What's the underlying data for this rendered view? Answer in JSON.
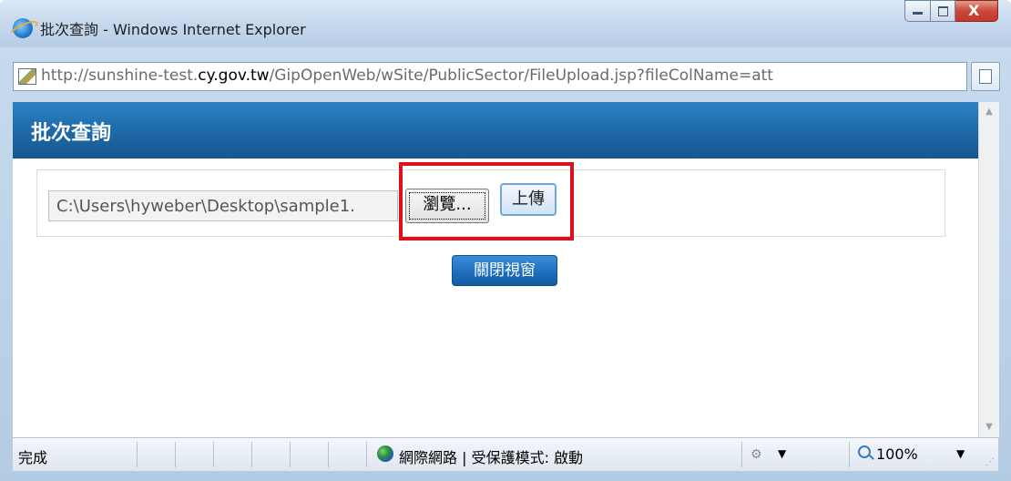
{
  "window": {
    "title": "批次查詢 - Windows Internet Explorer",
    "minimize_icon": "minimize-icon",
    "maximize_icon": "maximize-icon",
    "close_glyph": "X"
  },
  "address_bar": {
    "url_prefix": "http://sunshine-test.",
    "url_host": "cy.gov.tw",
    "url_suffix": "/GipOpenWeb/wSite/PublicSector/FileUpload.jsp?fileColName=att"
  },
  "page": {
    "header_title": "批次查詢",
    "file_input_value": "C:\\Users\\hyweber\\Desktop\\sample1.",
    "browse_label": "瀏覽...",
    "upload_label": "上傳",
    "close_window_label": "關閉視窗"
  },
  "status_bar": {
    "status": "完成",
    "zone": "網際網路 | 受保護模式: 啟動",
    "zoom": "100%"
  },
  "colors": {
    "header_blue": "#1e6aa9",
    "highlight_red": "#e0101a",
    "close_button_blue": "#1f6fbd"
  }
}
